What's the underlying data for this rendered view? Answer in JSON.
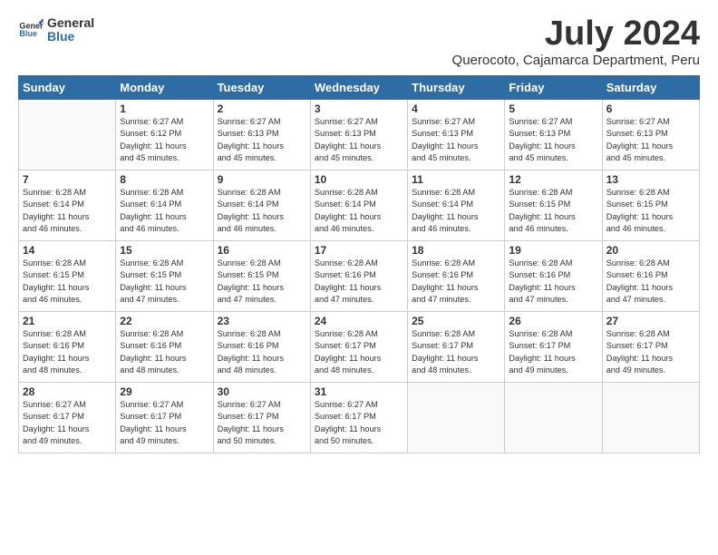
{
  "logo": {
    "text_general": "General",
    "text_blue": "Blue"
  },
  "header": {
    "month_title": "July 2024",
    "subtitle": "Querocoto, Cajamarca Department, Peru"
  },
  "weekdays": [
    "Sunday",
    "Monday",
    "Tuesday",
    "Wednesday",
    "Thursday",
    "Friday",
    "Saturday"
  ],
  "weeks": [
    [
      {
        "day": "",
        "info": ""
      },
      {
        "day": "1",
        "info": "Sunrise: 6:27 AM\nSunset: 6:12 PM\nDaylight: 11 hours\nand 45 minutes."
      },
      {
        "day": "2",
        "info": "Sunrise: 6:27 AM\nSunset: 6:13 PM\nDaylight: 11 hours\nand 45 minutes."
      },
      {
        "day": "3",
        "info": "Sunrise: 6:27 AM\nSunset: 6:13 PM\nDaylight: 11 hours\nand 45 minutes."
      },
      {
        "day": "4",
        "info": "Sunrise: 6:27 AM\nSunset: 6:13 PM\nDaylight: 11 hours\nand 45 minutes."
      },
      {
        "day": "5",
        "info": "Sunrise: 6:27 AM\nSunset: 6:13 PM\nDaylight: 11 hours\nand 45 minutes."
      },
      {
        "day": "6",
        "info": "Sunrise: 6:27 AM\nSunset: 6:13 PM\nDaylight: 11 hours\nand 45 minutes."
      }
    ],
    [
      {
        "day": "7",
        "info": "Sunrise: 6:28 AM\nSunset: 6:14 PM\nDaylight: 11 hours\nand 46 minutes."
      },
      {
        "day": "8",
        "info": "Sunrise: 6:28 AM\nSunset: 6:14 PM\nDaylight: 11 hours\nand 46 minutes."
      },
      {
        "day": "9",
        "info": "Sunrise: 6:28 AM\nSunset: 6:14 PM\nDaylight: 11 hours\nand 46 minutes."
      },
      {
        "day": "10",
        "info": "Sunrise: 6:28 AM\nSunset: 6:14 PM\nDaylight: 11 hours\nand 46 minutes."
      },
      {
        "day": "11",
        "info": "Sunrise: 6:28 AM\nSunset: 6:14 PM\nDaylight: 11 hours\nand 46 minutes."
      },
      {
        "day": "12",
        "info": "Sunrise: 6:28 AM\nSunset: 6:15 PM\nDaylight: 11 hours\nand 46 minutes."
      },
      {
        "day": "13",
        "info": "Sunrise: 6:28 AM\nSunset: 6:15 PM\nDaylight: 11 hours\nand 46 minutes."
      }
    ],
    [
      {
        "day": "14",
        "info": "Sunrise: 6:28 AM\nSunset: 6:15 PM\nDaylight: 11 hours\nand 46 minutes."
      },
      {
        "day": "15",
        "info": "Sunrise: 6:28 AM\nSunset: 6:15 PM\nDaylight: 11 hours\nand 47 minutes."
      },
      {
        "day": "16",
        "info": "Sunrise: 6:28 AM\nSunset: 6:15 PM\nDaylight: 11 hours\nand 47 minutes."
      },
      {
        "day": "17",
        "info": "Sunrise: 6:28 AM\nSunset: 6:16 PM\nDaylight: 11 hours\nand 47 minutes."
      },
      {
        "day": "18",
        "info": "Sunrise: 6:28 AM\nSunset: 6:16 PM\nDaylight: 11 hours\nand 47 minutes."
      },
      {
        "day": "19",
        "info": "Sunrise: 6:28 AM\nSunset: 6:16 PM\nDaylight: 11 hours\nand 47 minutes."
      },
      {
        "day": "20",
        "info": "Sunrise: 6:28 AM\nSunset: 6:16 PM\nDaylight: 11 hours\nand 47 minutes."
      }
    ],
    [
      {
        "day": "21",
        "info": "Sunrise: 6:28 AM\nSunset: 6:16 PM\nDaylight: 11 hours\nand 48 minutes."
      },
      {
        "day": "22",
        "info": "Sunrise: 6:28 AM\nSunset: 6:16 PM\nDaylight: 11 hours\nand 48 minutes."
      },
      {
        "day": "23",
        "info": "Sunrise: 6:28 AM\nSunset: 6:16 PM\nDaylight: 11 hours\nand 48 minutes."
      },
      {
        "day": "24",
        "info": "Sunrise: 6:28 AM\nSunset: 6:17 PM\nDaylight: 11 hours\nand 48 minutes."
      },
      {
        "day": "25",
        "info": "Sunrise: 6:28 AM\nSunset: 6:17 PM\nDaylight: 11 hours\nand 48 minutes."
      },
      {
        "day": "26",
        "info": "Sunrise: 6:28 AM\nSunset: 6:17 PM\nDaylight: 11 hours\nand 49 minutes."
      },
      {
        "day": "27",
        "info": "Sunrise: 6:28 AM\nSunset: 6:17 PM\nDaylight: 11 hours\nand 49 minutes."
      }
    ],
    [
      {
        "day": "28",
        "info": "Sunrise: 6:27 AM\nSunset: 6:17 PM\nDaylight: 11 hours\nand 49 minutes."
      },
      {
        "day": "29",
        "info": "Sunrise: 6:27 AM\nSunset: 6:17 PM\nDaylight: 11 hours\nand 49 minutes."
      },
      {
        "day": "30",
        "info": "Sunrise: 6:27 AM\nSunset: 6:17 PM\nDaylight: 11 hours\nand 50 minutes."
      },
      {
        "day": "31",
        "info": "Sunrise: 6:27 AM\nSunset: 6:17 PM\nDaylight: 11 hours\nand 50 minutes."
      },
      {
        "day": "",
        "info": ""
      },
      {
        "day": "",
        "info": ""
      },
      {
        "day": "",
        "info": ""
      }
    ]
  ]
}
